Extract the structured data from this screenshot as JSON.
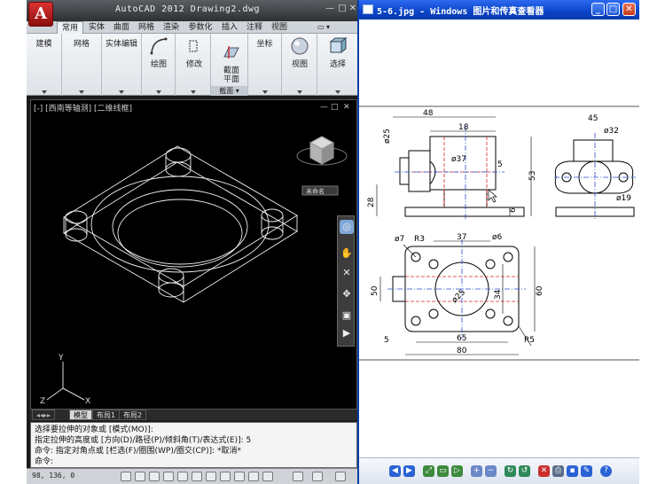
{
  "acad": {
    "logo_letter": "A",
    "title": "AutoCAD 2012    Drawing2.dwg",
    "window_controls": [
      "—",
      "□",
      "✕"
    ],
    "ribbon_tabs": [
      "常用",
      "实体",
      "曲面",
      "网格",
      "渲染",
      "参数化",
      "插入",
      "注释",
      "视图"
    ],
    "active_tab": "常用",
    "panels": {
      "modeling": "建模",
      "mesh": "网格",
      "solid_edit": "实体编辑",
      "draw": "绘图",
      "modify": "修改",
      "section": "截面\n平面",
      "section_footer": "截面",
      "coordinates": "坐标",
      "view": "视图",
      "select": "选择"
    },
    "viewport_label": "[-] [西南等轴测] [二维线框]",
    "viewport_controls": [
      "—",
      "□",
      "✕"
    ],
    "viewcube_label": "未命名",
    "ucs_labels": {
      "y": "Y",
      "x": "X",
      "z": "Z"
    },
    "model_tabs": [
      "模型",
      "布局1",
      "布局2"
    ],
    "active_model_tab": "模型",
    "command_history": [
      "选择要拉伸的对象或 [模式(MO)]:",
      "指定拉伸的高度或 [方向(D)/路径(P)/倾斜角(T)/表达式(E)]: 5",
      "命令: 指定对角点或 [栏选(F)/圈围(WP)/圈交(CP)]: *取消*"
    ],
    "command_prompt": "命令:",
    "status_coords": "98, 136, 0"
  },
  "viewer": {
    "title": "5-6.jpg - Windows 图片和传真查看器",
    "window_buttons": [
      "_",
      "□",
      "✕"
    ],
    "dims": {
      "d48": "48",
      "d18": "18",
      "d45": "45",
      "d32": "ø32",
      "d25": "ø25",
      "d37": "ø37",
      "d5": "5",
      "d53": "53",
      "d28": "28",
      "d6": "6",
      "d19": "ø19",
      "d7": "ø7",
      "r3": "R3",
      "d37b": "37",
      "d6b": "ø6",
      "d50": "50",
      "d34": "34",
      "d60": "60",
      "d5b": "5",
      "d65": "65",
      "d80": "80",
      "r5": "R5",
      "dcircle": "ø25"
    },
    "toolbar_icons": [
      "prev-icon",
      "next-icon",
      "best-fit-icon",
      "actual-size-icon",
      "slideshow-icon",
      "zoom-in-icon",
      "zoom-out-icon",
      "rotate-cw-icon",
      "rotate-ccw-icon",
      "delete-icon",
      "print-icon",
      "save-icon",
      "edit-icon",
      "help-icon"
    ]
  }
}
